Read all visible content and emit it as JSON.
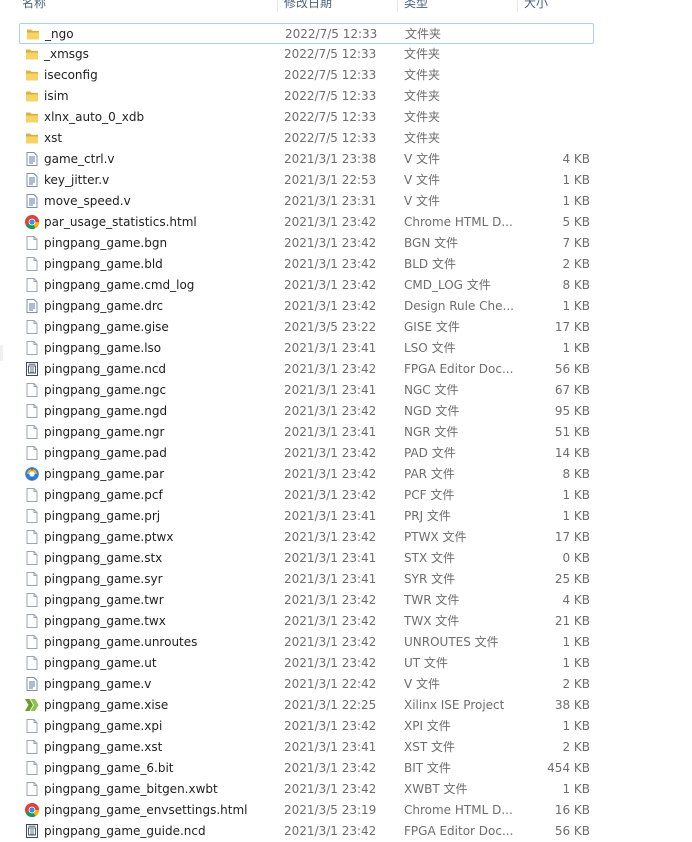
{
  "header": {
    "name": "名称",
    "date": "修改日期",
    "type": "类型",
    "size": "大小"
  },
  "files": [
    {
      "name": "_ngo",
      "date": "2022/7/5 12:33",
      "type": "文件夹",
      "size": "",
      "icon": "folder"
    },
    {
      "name": "_xmsgs",
      "date": "2022/7/5 12:33",
      "type": "文件夹",
      "size": "",
      "icon": "folder"
    },
    {
      "name": "iseconfig",
      "date": "2022/7/5 12:33",
      "type": "文件夹",
      "size": "",
      "icon": "folder"
    },
    {
      "name": "isim",
      "date": "2022/7/5 12:33",
      "type": "文件夹",
      "size": "",
      "icon": "folder"
    },
    {
      "name": "xlnx_auto_0_xdb",
      "date": "2022/7/5 12:33",
      "type": "文件夹",
      "size": "",
      "icon": "folder"
    },
    {
      "name": "xst",
      "date": "2022/7/5 12:33",
      "type": "文件夹",
      "size": "",
      "icon": "folder"
    },
    {
      "name": "game_ctrl.v",
      "date": "2021/3/1 23:38",
      "type": "V 文件",
      "size": "4 KB",
      "icon": "text"
    },
    {
      "name": "key_jitter.v",
      "date": "2021/3/1 22:53",
      "type": "V 文件",
      "size": "1 KB",
      "icon": "text"
    },
    {
      "name": "move_speed.v",
      "date": "2021/3/1 23:31",
      "type": "V 文件",
      "size": "1 KB",
      "icon": "text"
    },
    {
      "name": "par_usage_statistics.html",
      "date": "2021/3/1 23:42",
      "type": "Chrome HTML D...",
      "size": "5 KB",
      "icon": "chrome"
    },
    {
      "name": "pingpang_game.bgn",
      "date": "2021/3/1 23:42",
      "type": "BGN 文件",
      "size": "7 KB",
      "icon": "blank"
    },
    {
      "name": "pingpang_game.bld",
      "date": "2021/3/1 23:42",
      "type": "BLD 文件",
      "size": "2 KB",
      "icon": "blank"
    },
    {
      "name": "pingpang_game.cmd_log",
      "date": "2021/3/1 23:42",
      "type": "CMD_LOG 文件",
      "size": "8 KB",
      "icon": "blank"
    },
    {
      "name": "pingpang_game.drc",
      "date": "2021/3/1 23:42",
      "type": "Design Rule Che...",
      "size": "1 KB",
      "icon": "text"
    },
    {
      "name": "pingpang_game.gise",
      "date": "2021/3/5 23:22",
      "type": "GISE 文件",
      "size": "17 KB",
      "icon": "blank"
    },
    {
      "name": "pingpang_game.lso",
      "date": "2021/3/1 23:41",
      "type": "LSO 文件",
      "size": "1 KB",
      "icon": "blank"
    },
    {
      "name": "pingpang_game.ncd",
      "date": "2021/3/1 23:42",
      "type": "FPGA Editor Doc...",
      "size": "56 KB",
      "icon": "fpga"
    },
    {
      "name": "pingpang_game.ngc",
      "date": "2021/3/1 23:41",
      "type": "NGC 文件",
      "size": "67 KB",
      "icon": "blank"
    },
    {
      "name": "pingpang_game.ngd",
      "date": "2021/3/1 23:42",
      "type": "NGD 文件",
      "size": "95 KB",
      "icon": "blank"
    },
    {
      "name": "pingpang_game.ngr",
      "date": "2021/3/1 23:41",
      "type": "NGR 文件",
      "size": "51 KB",
      "icon": "blank"
    },
    {
      "name": "pingpang_game.pad",
      "date": "2021/3/1 23:42",
      "type": "PAD 文件",
      "size": "14 KB",
      "icon": "blank"
    },
    {
      "name": "pingpang_game.par",
      "date": "2021/3/1 23:42",
      "type": "PAR 文件",
      "size": "8 KB",
      "icon": "par"
    },
    {
      "name": "pingpang_game.pcf",
      "date": "2021/3/1 23:42",
      "type": "PCF 文件",
      "size": "1 KB",
      "icon": "blank"
    },
    {
      "name": "pingpang_game.prj",
      "date": "2021/3/1 23:41",
      "type": "PRJ 文件",
      "size": "1 KB",
      "icon": "blank"
    },
    {
      "name": "pingpang_game.ptwx",
      "date": "2021/3/1 23:42",
      "type": "PTWX 文件",
      "size": "17 KB",
      "icon": "blank"
    },
    {
      "name": "pingpang_game.stx",
      "date": "2021/3/1 23:41",
      "type": "STX 文件",
      "size": "0 KB",
      "icon": "blank"
    },
    {
      "name": "pingpang_game.syr",
      "date": "2021/3/1 23:41",
      "type": "SYR 文件",
      "size": "25 KB",
      "icon": "blank"
    },
    {
      "name": "pingpang_game.twr",
      "date": "2021/3/1 23:42",
      "type": "TWR 文件",
      "size": "4 KB",
      "icon": "blank"
    },
    {
      "name": "pingpang_game.twx",
      "date": "2021/3/1 23:42",
      "type": "TWX 文件",
      "size": "21 KB",
      "icon": "blank"
    },
    {
      "name": "pingpang_game.unroutes",
      "date": "2021/3/1 23:42",
      "type": "UNROUTES 文件",
      "size": "1 KB",
      "icon": "blank"
    },
    {
      "name": "pingpang_game.ut",
      "date": "2021/3/1 23:42",
      "type": "UT 文件",
      "size": "1 KB",
      "icon": "blank"
    },
    {
      "name": "pingpang_game.v",
      "date": "2021/3/1 22:42",
      "type": "V 文件",
      "size": "2 KB",
      "icon": "text"
    },
    {
      "name": "pingpang_game.xise",
      "date": "2021/3/1 22:25",
      "type": "Xilinx ISE Project",
      "size": "38 KB",
      "icon": "xilinx"
    },
    {
      "name": "pingpang_game.xpi",
      "date": "2021/3/1 23:42",
      "type": "XPI 文件",
      "size": "1 KB",
      "icon": "blank"
    },
    {
      "name": "pingpang_game.xst",
      "date": "2021/3/1 23:41",
      "type": "XST 文件",
      "size": "2 KB",
      "icon": "blank"
    },
    {
      "name": "pingpang_game_6.bit",
      "date": "2021/3/1 23:42",
      "type": "BIT 文件",
      "size": "454 KB",
      "icon": "blank"
    },
    {
      "name": "pingpang_game_bitgen.xwbt",
      "date": "2021/3/1 23:42",
      "type": "XWBT 文件",
      "size": "1 KB",
      "icon": "blank"
    },
    {
      "name": "pingpang_game_envsettings.html",
      "date": "2021/3/5 23:19",
      "type": "Chrome HTML D...",
      "size": "16 KB",
      "icon": "chrome"
    },
    {
      "name": "pingpang_game_guide.ncd",
      "date": "2021/3/1 23:42",
      "type": "FPGA Editor Doc...",
      "size": "56 KB",
      "icon": "fpga"
    }
  ],
  "selected_index": 0
}
